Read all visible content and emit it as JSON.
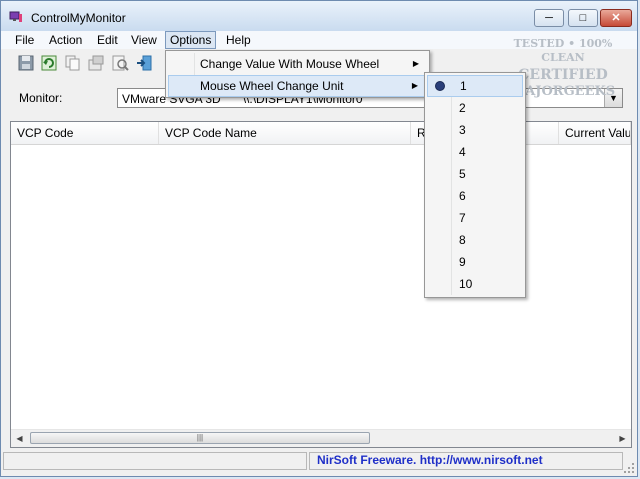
{
  "window": {
    "title": "ControlMyMonitor"
  },
  "titlebar": {
    "minimize_icon": "minimize-icon",
    "maximize_icon": "maximize-icon",
    "close_icon": "close-icon"
  },
  "menubar": {
    "items": [
      "File",
      "Action",
      "Edit",
      "View",
      "Options",
      "Help"
    ],
    "active": "Options"
  },
  "toolbar": {
    "icons": [
      "save-icon",
      "refresh-icon",
      "copy-icon",
      "properties-icon",
      "find-icon",
      "exit-icon"
    ]
  },
  "monitor": {
    "label": "Monitor:",
    "selected_name": "VMware SVGA 3D",
    "selected_path": "\\\\.\\DISPLAY1\\Monitor0"
  },
  "list": {
    "columns": [
      "VCP Code",
      "VCP Code Name",
      "R",
      "Current Valu"
    ]
  },
  "options_menu": {
    "items": [
      {
        "label": "Change Value With Mouse Wheel"
      },
      {
        "label": "Mouse Wheel Change Unit"
      }
    ]
  },
  "unit_submenu": {
    "items": [
      "1",
      "2",
      "3",
      "4",
      "5",
      "6",
      "7",
      "8",
      "9",
      "10"
    ],
    "selected": "1"
  },
  "statusbar": {
    "text": "NirSoft Freeware.  http://www.nirsoft.net"
  },
  "watermark": {
    "lines": [
      "TESTED • 100% CLEAN",
      "CERTIFIED",
      "MAJORGEEKS"
    ]
  }
}
